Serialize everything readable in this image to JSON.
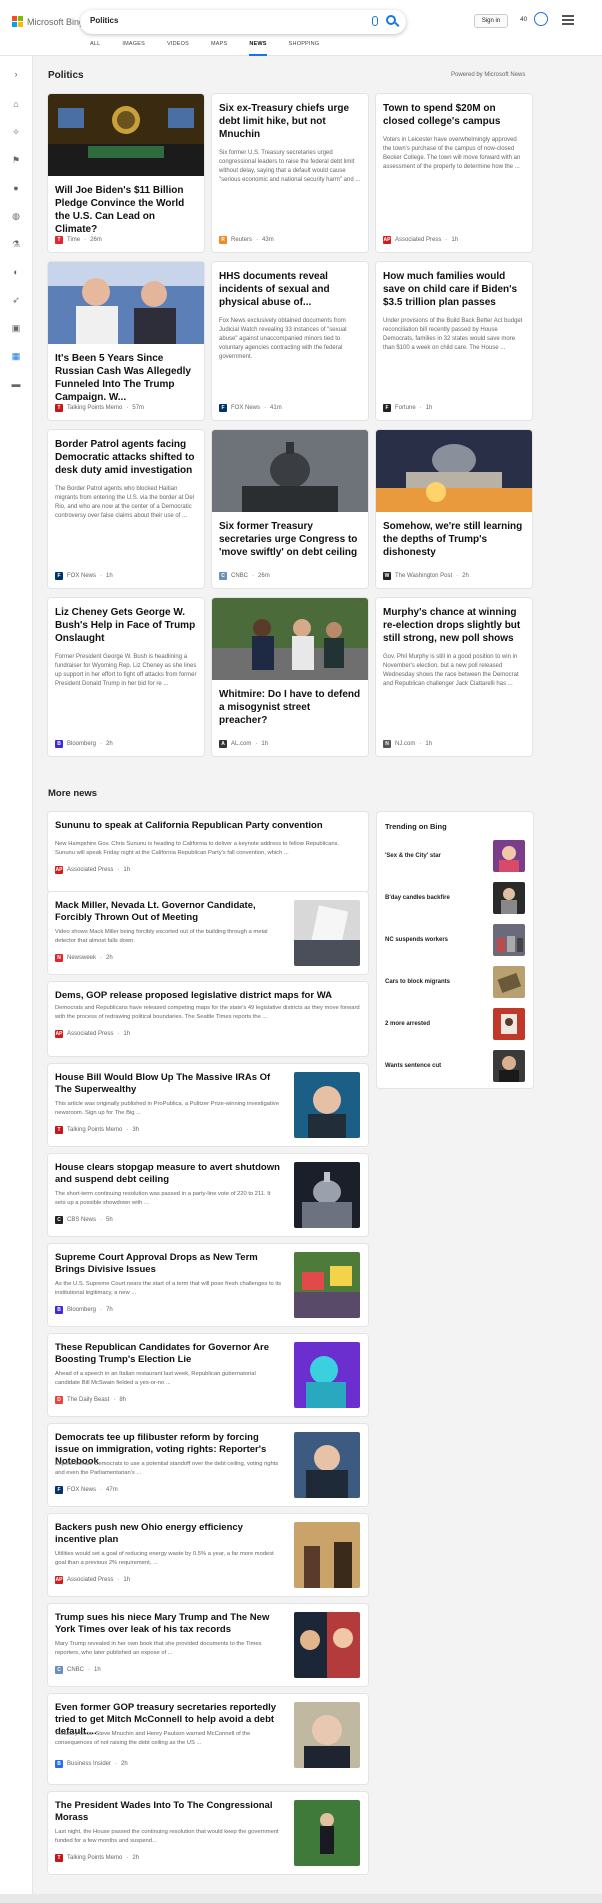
{
  "header": {
    "brand": "Microsoft Bing",
    "search_value": "Politics",
    "signin": "Sign in",
    "points": "40",
    "tabs": [
      "ALL",
      "IMAGES",
      "VIDEOS",
      "MAPS",
      "NEWS",
      "SHOPPING"
    ],
    "active_tab": "NEWS"
  },
  "section": {
    "title": "Politics",
    "powered": "Powered by Microsoft News"
  },
  "cards": [
    {
      "title": "Will Joe Biden's $11 Billion Pledge Convince the World the U.S. Can Lead on Climate?",
      "desc": "",
      "source": "Time",
      "time": "26m",
      "icon_color": "#e0262e",
      "icon_letter": "T"
    },
    {
      "title": "Six ex-Treasury chiefs urge debt limit hike, but not Mnuchin",
      "desc": "Six former U.S. Treasury secretaries urged congressional leaders to raise the federal debt limit without delay, saying that a default would cause \"serious economic and national security harm\" and ...",
      "source": "Reuters",
      "time": "43m",
      "icon_color": "#f08a24",
      "icon_letter": "R"
    },
    {
      "title": "Town to spend $20M on closed college's campus",
      "desc": "Voters in Leicester have overwhelmingly approved the town's purchase of the campus of now-closed Becker College. The town will move forward with an assessment of the property to determine how the ...",
      "source": "Associated Press",
      "time": "1h",
      "icon_color": "#d41c1c",
      "icon_letter": "AP"
    },
    {
      "title": "It's Been 5 Years Since Russian Cash Was Allegedly Funneled Into The Trump Campaign. W...",
      "desc": "",
      "source": "Talking Points Memo",
      "time": "57m",
      "icon_color": "#c4161c",
      "icon_letter": "T"
    },
    {
      "title": "HHS documents reveal incidents of sexual and physical abuse of...",
      "desc": "Fox News exclusively obtained documents from Judicial Watch revealing 33 instances of \"sexual abuse\" against unaccompanied minors tied to voluntary agencies contracting with the federal government.",
      "source": "FOX News",
      "time": "41m",
      "icon_color": "#003366",
      "icon_letter": "F"
    },
    {
      "title": "How much families would save on child care if Biden's $3.5 trillion plan passes",
      "desc": "Under provisions of the Build Back Better Act budget reconciliation bill recently passed by House Democrats, families in 32 states would save more than $100 a week on child care. The House ...",
      "source": "Fortune",
      "time": "1h",
      "icon_color": "#222222",
      "icon_letter": "F"
    },
    {
      "title": "Border Patrol agents facing Democratic attacks shifted to desk duty amid investigation",
      "desc": "The Border Patrol agents who blocked Haitian migrants from entering the U.S. via the border at Del Rio, and who are now at the center of a Democratic controversy over false claims about their use of ...",
      "source": "FOX News",
      "time": "1h",
      "icon_color": "#003366",
      "icon_letter": "F"
    },
    {
      "title": "Six former Treasury secretaries urge Congress to 'move swiftly' on debt ceiling",
      "desc": "",
      "source": "CNBC",
      "time": "26m",
      "icon_color": "#6c8ebf",
      "icon_letter": "C"
    },
    {
      "title": "Somehow, we're still learning the depths of Trump's dishonesty",
      "desc": "",
      "source": "The Washington Post",
      "time": "2h",
      "icon_color": "#222222",
      "icon_letter": "W"
    },
    {
      "title": "Liz Cheney Gets George W. Bush's Help in Face of Trump Onslaught",
      "desc": "Former President George W. Bush is headlining a fundraiser for Wyoming Rep. Liz Cheney as she lines up support in her effort to fight off attacks from former President Donald Trump in her bid for re ...",
      "source": "Bloomberg",
      "time": "2h",
      "icon_color": "#3f2bd8",
      "icon_letter": "B"
    },
    {
      "title": "Whitmire: Do I have to defend a misogynist street preacher?",
      "desc": "",
      "source": "AL.com",
      "time": "1h",
      "icon_color": "#333333",
      "icon_letter": "A"
    },
    {
      "title": "Murphy's chance at winning re-election drops slightly but still strong, new poll shows",
      "desc": "Gov. Phil Murphy is still in a good position to win in November's election, but a new poll released Wednesday shows the race between the Democrat and Republican challenger Jack Ciattarelli has ...",
      "source": "NJ.com",
      "time": "1h",
      "icon_color": "#555555",
      "icon_letter": "N"
    }
  ],
  "more_news": {
    "title": "More news",
    "items": [
      {
        "title": "Sununu to speak at California Republican Party convention",
        "desc": "New Hampshire Gov. Chris Sununu is heading to California to deliver a keynote address to fellow Republicans. Sununu will speak Friday night at the California Republican Party's fall convention, which ...",
        "source": "Associated Press",
        "time": "1h",
        "icon_color": "#d41c1c",
        "icon_letter": "AP"
      },
      {
        "title": "Mack Miller, Nevada Lt. Governor Candidate, Forcibly Thrown Out of Meeting",
        "desc": "Video shows Mack Miller being forcibly escorted out of the building through a metal detector that almost falls down.",
        "source": "Newsweek",
        "time": "2h",
        "icon_color": "#e0262e",
        "icon_letter": "N"
      },
      {
        "title": "Dems, GOP release proposed legislative district maps for WA",
        "desc": "Democrats and Republicans have released competing maps for the state's 49 legislative districts as they move forward with the process of redrawing political boundaries. The Seattle Times reports the ...",
        "source": "Associated Press",
        "time": "1h",
        "icon_color": "#d41c1c",
        "icon_letter": "AP"
      },
      {
        "title": "House Bill Would Blow Up The Massive IRAs Of The Superwealthy",
        "desc": "This article was originally published in ProPublica, a Pulitzer Prize-winning investigative newsroom. Sign up for The Big ...",
        "source": "Talking Points Memo",
        "time": "3h",
        "icon_color": "#c4161c",
        "icon_letter": "T"
      },
      {
        "title": "House clears stopgap measure to avert shutdown and suspend debt ceiling",
        "desc": "The short-term continuing resolution was passed in a party-line vote of 220 to 211. It sets up a possible showdown with ...",
        "source": "CBS News",
        "time": "5h",
        "icon_color": "#222222",
        "icon_letter": "C"
      },
      {
        "title": "Supreme Court Approval Drops as New Term Brings Divisive Issues",
        "desc": "As the U.S. Supreme Court nears the start of a term that will pose fresh challenges to its institutional legitimacy, a new ...",
        "source": "Bloomberg",
        "time": "7h",
        "icon_color": "#3f2bd8",
        "icon_letter": "B"
      },
      {
        "title": "These Republican Candidates for Governor Are Boosting Trump's Election Lie",
        "desc": "Ahead of a speech in an Italian restaurant last week, Republican gubernatorial candidate Bill McSwain fielded a yes-or-no ...",
        "source": "The Daily Beast",
        "time": "8h",
        "icon_color": "#e8453c",
        "icon_letter": "D"
      },
      {
        "title": "Democrats tee up filibuster reform by forcing issue on immigration, voting rights: Reporter's Notebook",
        "desc": "Expect Senate Democrats to use a potential standoff over the debt ceiling, voting rights and even the Parliamentarian's ...",
        "source": "FOX News",
        "time": "47m",
        "icon_color": "#003366",
        "icon_letter": "F"
      },
      {
        "title": "Backers push new Ohio energy efficiency incentive plan",
        "desc": "Utilities would set a goal of reducing energy waste by 0.5% a year, a far more modest goal than a previous 2% requirement, ...",
        "source": "Associated Press",
        "time": "1h",
        "icon_color": "#d41c1c",
        "icon_letter": "AP"
      },
      {
        "title": "Trump sues his niece Mary Trump and The New York Times over leak of his tax records",
        "desc": "Mary Trump revealed in her own book that she provided documents to the Times reporters, who later published an expose of ...",
        "source": "CNBC",
        "time": "1h",
        "icon_color": "#6c8ebf",
        "icon_letter": "C"
      },
      {
        "title": "Even former GOP treasury secretaries reportedly tried to get Mitch McConnell to help avoid a debt default....",
        "desc": "Treasury Secs. Steve Mnuchin and Henry Paulson warned McConnell of the consequences of not raising the debt ceiling as the US ...",
        "source": "Business Insider",
        "time": "2h",
        "icon_color": "#2a6cf0",
        "icon_letter": "B"
      },
      {
        "title": "The President Wades Into To The Congressional Morass",
        "desc": "Last night, the House passed the continuing resolution that would keep the government funded for a few months and suspend...",
        "source": "Talking Points Memo",
        "time": "2h",
        "icon_color": "#c4161c",
        "icon_letter": "T"
      }
    ]
  },
  "trending": {
    "title": "Trending on Bing",
    "items": [
      "'Sex & the City' star",
      "B'day candles backfire",
      "NC suspends workers",
      "Cars to block migrants",
      "2 more arrested",
      "Wants sentence cut"
    ]
  }
}
